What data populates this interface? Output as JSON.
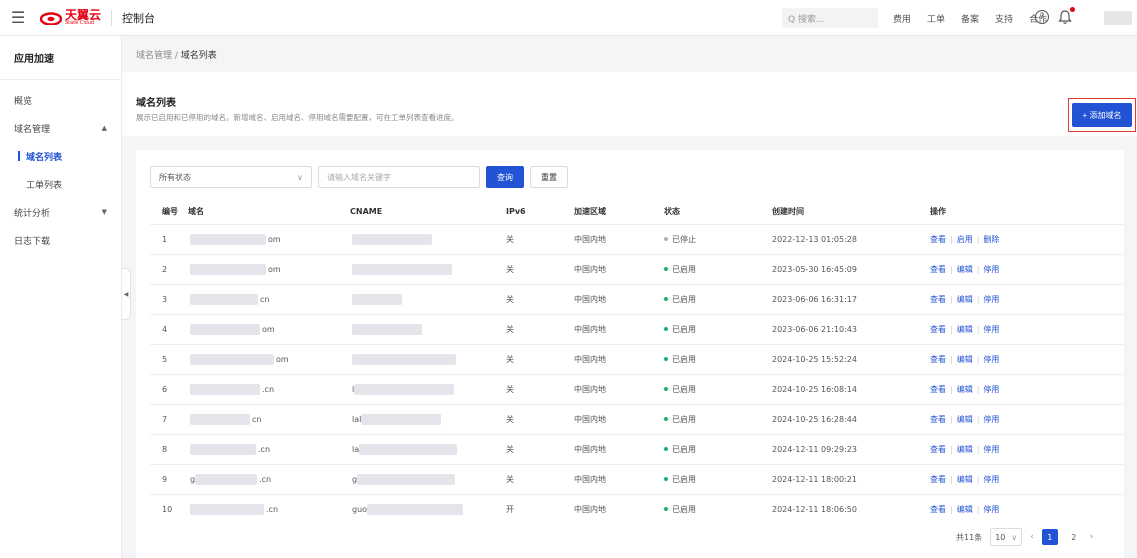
{
  "topbar": {
    "logo_cn": "天翼云",
    "logo_en": "State Cloud",
    "console": "控制台",
    "search_placeholder": "Q 搜索...",
    "nav": [
      "费用",
      "工单",
      "备案",
      "支持",
      "合作"
    ],
    "help": "?"
  },
  "sidebar": {
    "title": "应用加速",
    "items": [
      {
        "label": "概览"
      },
      {
        "label": "域名管理",
        "arrow": "▲"
      },
      {
        "label": "域名列表"
      },
      {
        "label": "工单列表"
      },
      {
        "label": "统计分析",
        "arrow": "▼"
      },
      {
        "label": "日志下载"
      }
    ]
  },
  "breadcrumb": {
    "parent": "域名管理",
    "sep": " / ",
    "current": "域名列表"
  },
  "header": {
    "title": "域名列表",
    "desc": "展示已启用和已停用的域名。新增域名、启用域名、停用域名需要配置，可在工单列表查看进度。",
    "add_button": "+ 添加域名"
  },
  "filters": {
    "status": "所有状态",
    "keyword_placeholder": "请输入域名关键字",
    "query": "查询",
    "reset": "重置"
  },
  "table": {
    "headers": [
      "编号",
      "域名",
      "CNAME",
      "IPv6",
      "加速区域",
      "状态",
      "创建时间",
      "操作"
    ],
    "rows": [
      {
        "no": "1",
        "domain_pre": "",
        "domain": "om",
        "cname_pre": "",
        "cname": "",
        "ipv6": "关",
        "region": "中国内地",
        "status": "已停止",
        "on": false,
        "time": "2022-12-13 01:05:28",
        "ops": [
          "查看",
          "启用",
          "删除"
        ]
      },
      {
        "no": "2",
        "domain_pre": "",
        "domain": "om",
        "cname_pre": "",
        "cname": "",
        "ipv6": "关",
        "region": "中国内地",
        "status": "已启用",
        "on": true,
        "time": "2023-05-30 16:45:09",
        "ops": [
          "查看",
          "编辑",
          "停用"
        ]
      },
      {
        "no": "3",
        "domain_pre": "",
        "domain": "cn",
        "cname_pre": "",
        "cname": "",
        "ipv6": "关",
        "region": "中国内地",
        "status": "已启用",
        "on": true,
        "time": "2023-06-06 16:31:17",
        "ops": [
          "查看",
          "编辑",
          "停用"
        ]
      },
      {
        "no": "4",
        "domain_pre": "",
        "domain": "om",
        "cname_pre": "",
        "cname": "",
        "ipv6": "关",
        "region": "中国内地",
        "status": "已启用",
        "on": true,
        "time": "2023-06-06 21:10:43",
        "ops": [
          "查看",
          "编辑",
          "停用"
        ]
      },
      {
        "no": "5",
        "domain_pre": "",
        "domain": "om",
        "cname_pre": "",
        "cname": "",
        "ipv6": "关",
        "region": "中国内地",
        "status": "已启用",
        "on": true,
        "time": "2024-10-25 15:52:24",
        "ops": [
          "查看",
          "编辑",
          "停用"
        ]
      },
      {
        "no": "6",
        "domain_pre": "",
        "domain": ".cn",
        "cname_pre": "l",
        "cname": "",
        "ipv6": "关",
        "region": "中国内地",
        "status": "已启用",
        "on": true,
        "time": "2024-10-25 16:08:14",
        "ops": [
          "查看",
          "编辑",
          "停用"
        ]
      },
      {
        "no": "7",
        "domain_pre": "",
        "domain": "cn",
        "cname_pre": "lal",
        "cname": "",
        "ipv6": "关",
        "region": "中国内地",
        "status": "已启用",
        "on": true,
        "time": "2024-10-25 16:28:44",
        "ops": [
          "查看",
          "编辑",
          "停用"
        ]
      },
      {
        "no": "8",
        "domain_pre": "",
        "domain": ".cn",
        "cname_pre": "la",
        "cname": "",
        "ipv6": "关",
        "region": "中国内地",
        "status": "已启用",
        "on": true,
        "time": "2024-12-11 09:29:23",
        "ops": [
          "查看",
          "编辑",
          "停用"
        ]
      },
      {
        "no": "9",
        "domain_pre": "g",
        "domain": ".cn",
        "cname_pre": "g",
        "cname": "",
        "ipv6": "关",
        "region": "中国内地",
        "status": "已启用",
        "on": true,
        "time": "2024-12-11 18:00:21",
        "ops": [
          "查看",
          "编辑",
          "停用"
        ]
      },
      {
        "no": "10",
        "domain_pre": "",
        "domain": ".cn",
        "cname_pre": "guo",
        "cname": "",
        "ipv6": "开",
        "region": "中国内地",
        "status": "已启用",
        "on": true,
        "time": "2024-12-11 18:06:50",
        "ops": [
          "查看",
          "编辑",
          "停用"
        ]
      }
    ]
  },
  "pager": {
    "total": "共11条",
    "page_size": "10",
    "pages": [
      "1",
      "2"
    ],
    "current": "1"
  }
}
